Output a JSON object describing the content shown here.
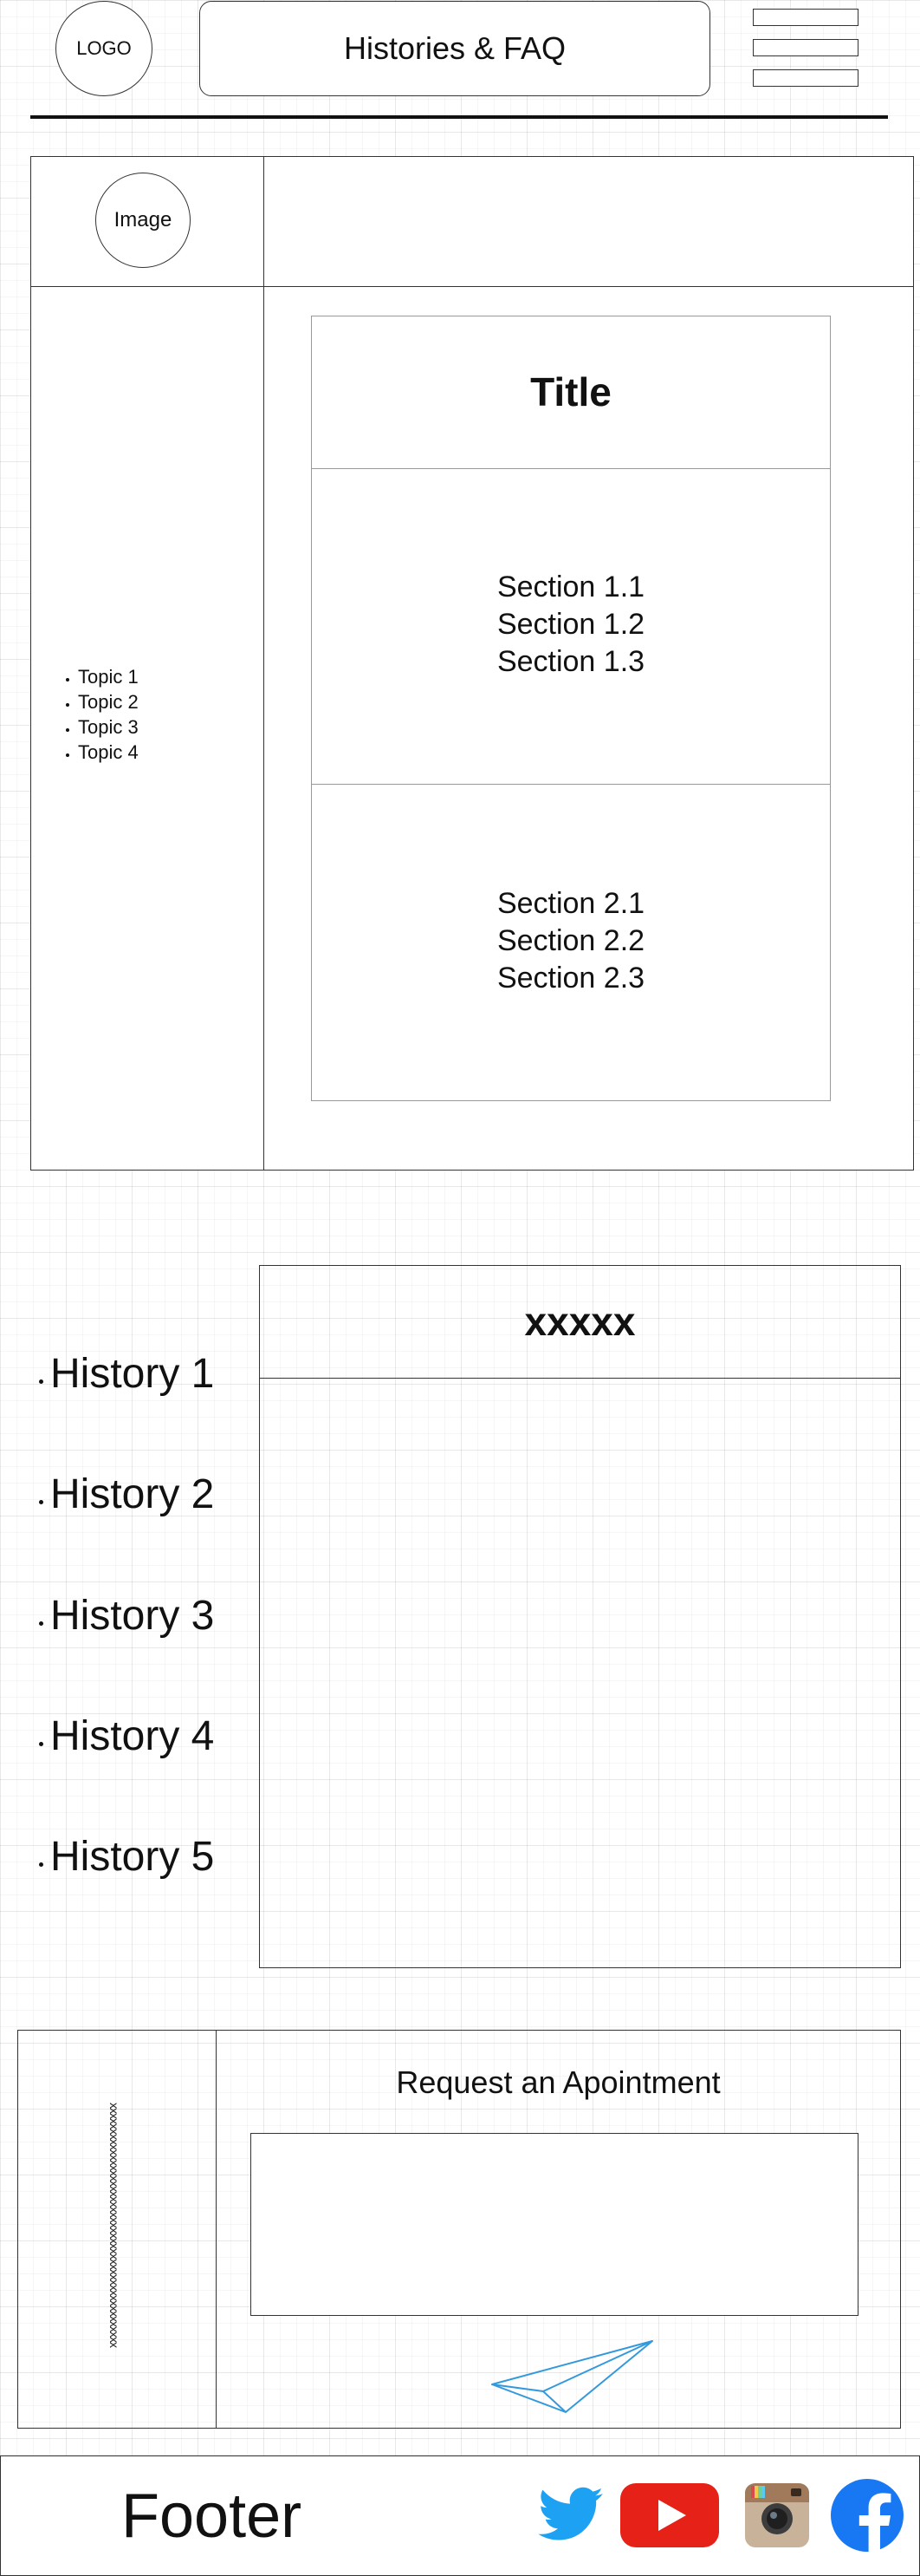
{
  "header": {
    "logo_label": "LOGO",
    "title": "Histories & FAQ",
    "menu_icon": "hamburger-icon"
  },
  "profile": {
    "image_label": "Image"
  },
  "topics": [
    "Topic 1",
    "Topic 2",
    "Topic 3",
    "Topic 4"
  ],
  "card": {
    "title": "Title",
    "section1": [
      "Section 1.1",
      "Section 1.2",
      "Section 1.3"
    ],
    "section2": [
      "Section 2.1",
      "Section 2.2",
      "Section 2.3"
    ]
  },
  "histories": [
    "History 1",
    "History 2",
    "History 3",
    "History 4",
    "History 5"
  ],
  "history_panel": {
    "heading": "xxxxx"
  },
  "appointment": {
    "side_text": "xxxxxxxxxxxxxxxxxxxxxxxxxxxxxxxxxxxxxxxxxxxxxxx",
    "title": "Request an Apointment",
    "send_icon": "paper-plane-icon"
  },
  "footer": {
    "label": "Footer",
    "social_icons": [
      "twitter-icon",
      "youtube-icon",
      "instagram-icon",
      "facebook-icon"
    ]
  },
  "colors": {
    "twitter": "#1da1f2",
    "youtube": "#e62117",
    "facebook": "#1877f2",
    "send_icon": "#3399dd"
  }
}
